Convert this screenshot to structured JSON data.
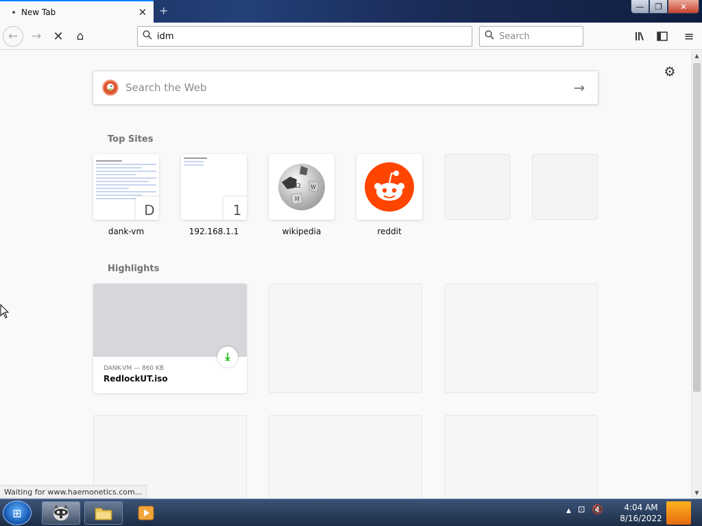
{
  "tab": {
    "title": "New Tab",
    "close": "✕",
    "new": "+"
  },
  "window": {
    "minimize": "—",
    "maximize": "❐",
    "close": "✕"
  },
  "nav": {
    "back": "←",
    "forward": "→",
    "stop": "✕",
    "home": "⌂",
    "url_value": "idm",
    "search_placeholder": "Search",
    "library": "|||\\",
    "sidebar": "▯",
    "menu": "≡"
  },
  "newtab": {
    "websearch_placeholder": "Search the Web",
    "websearch_go": "→",
    "settings": "⚙",
    "top_sites_title": "Top Sites",
    "top_sites": [
      {
        "label": "dank-vm",
        "badge": "D"
      },
      {
        "label": "192.168.1.1",
        "badge": "1"
      },
      {
        "label": "wikipedia",
        "badge": ""
      },
      {
        "label": "reddit",
        "badge": ""
      },
      {
        "label": "",
        "badge": ""
      },
      {
        "label": "",
        "badge": ""
      }
    ],
    "highlights_title": "Highlights",
    "highlight": {
      "meta": "DANK-VM — 860 KB",
      "name": "RedlockUT.iso",
      "download_icon": "⤓"
    }
  },
  "status_text": "Waiting for www.haemonetics.com...",
  "taskbar": {
    "start": "⊞",
    "clock_time": "4:04 AM",
    "clock_date": "8/16/2022",
    "tray": [
      "▲",
      "⊡",
      "🔇"
    ]
  },
  "colors": {
    "accent": "#0a84ff",
    "ddg": "#de5833",
    "reddit": "#ff4500",
    "download": "#12bc00"
  }
}
